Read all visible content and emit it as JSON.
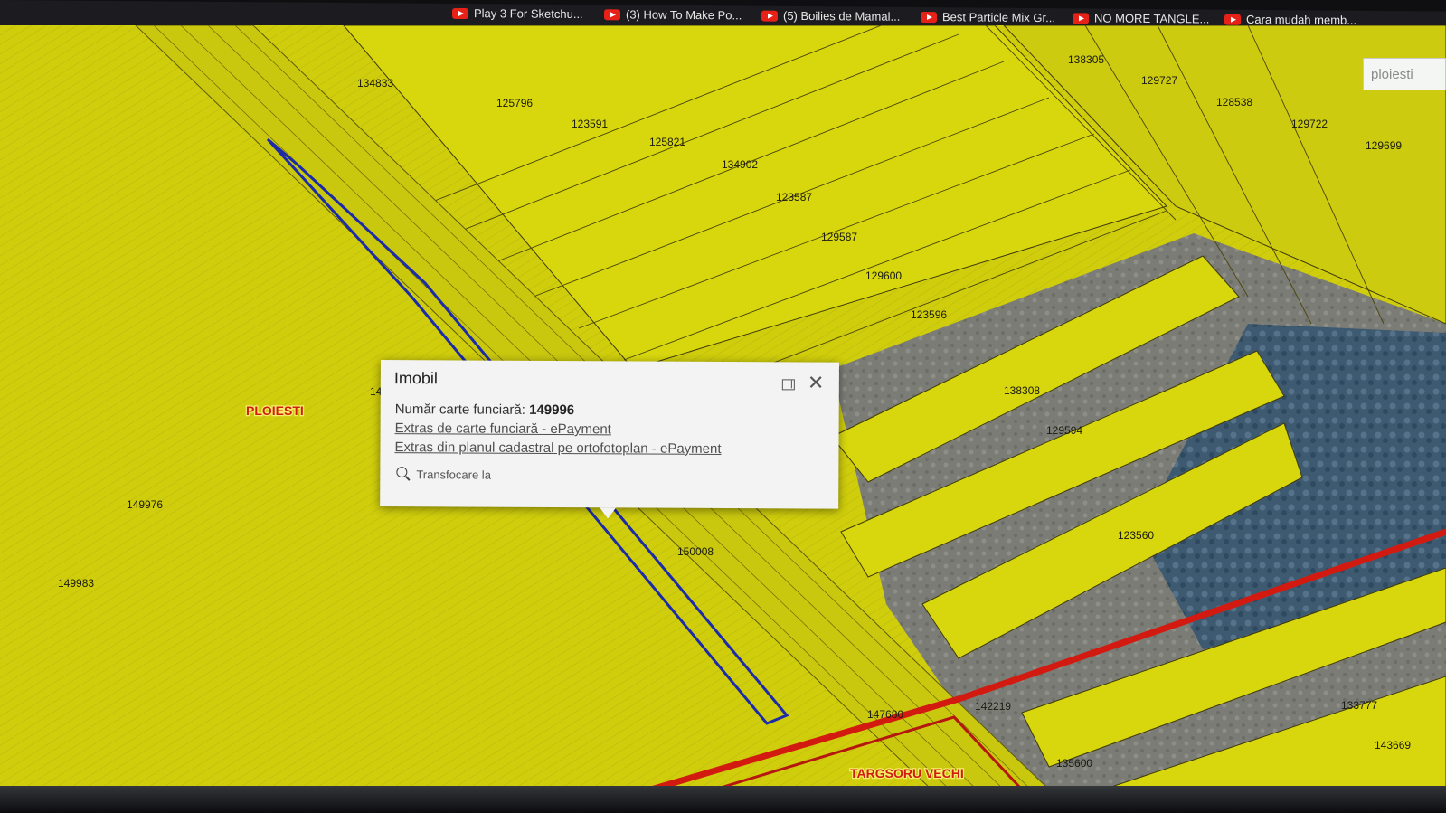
{
  "browser": {
    "bookmarks": [
      {
        "label": "Play 3 For Sketchu...",
        "icon": "youtube-icon"
      },
      {
        "label": "(3) How To Make Po...",
        "icon": "youtube-icon"
      },
      {
        "label": "(5) Boilies de Mamal...",
        "icon": "youtube-icon"
      },
      {
        "label": "Best Particle Mix Gr...",
        "icon": "youtube-icon"
      },
      {
        "label": "NO MORE TANGLE...",
        "icon": "youtube-icon"
      },
      {
        "label": "Cara mudah memb...",
        "icon": "youtube-icon"
      }
    ]
  },
  "map": {
    "search_value": "ploiesti",
    "colors": {
      "parcel_fill": "#d8d70e",
      "parcel_outline": "#3f3a05",
      "selected_outline": "#1c2ba8",
      "limit_line": "#d21a10"
    },
    "parcels": [
      "134833",
      "125796",
      "123591",
      "125821",
      "134902",
      "123587",
      "129587",
      "129600",
      "123596",
      "138305",
      "129727",
      "128538",
      "129722",
      "129699",
      "138308",
      "129594",
      "123560",
      "150008",
      "149976",
      "149983",
      "147680",
      "142219",
      "135600",
      "133777",
      "143669",
      "14"
    ],
    "places": [
      "PLOIESTI",
      "TARGSORU VECHI"
    ]
  },
  "popup": {
    "title": "Imobil",
    "cf_label": "Număr carte funciară:",
    "cf_number": "149996",
    "link_extract_cf": "Extras de carte funciară - ePayment",
    "link_extract_plan": "Extras din planul cadastral pe ortofotoplan - ePayment",
    "zoom_label": "Transfocare la"
  }
}
